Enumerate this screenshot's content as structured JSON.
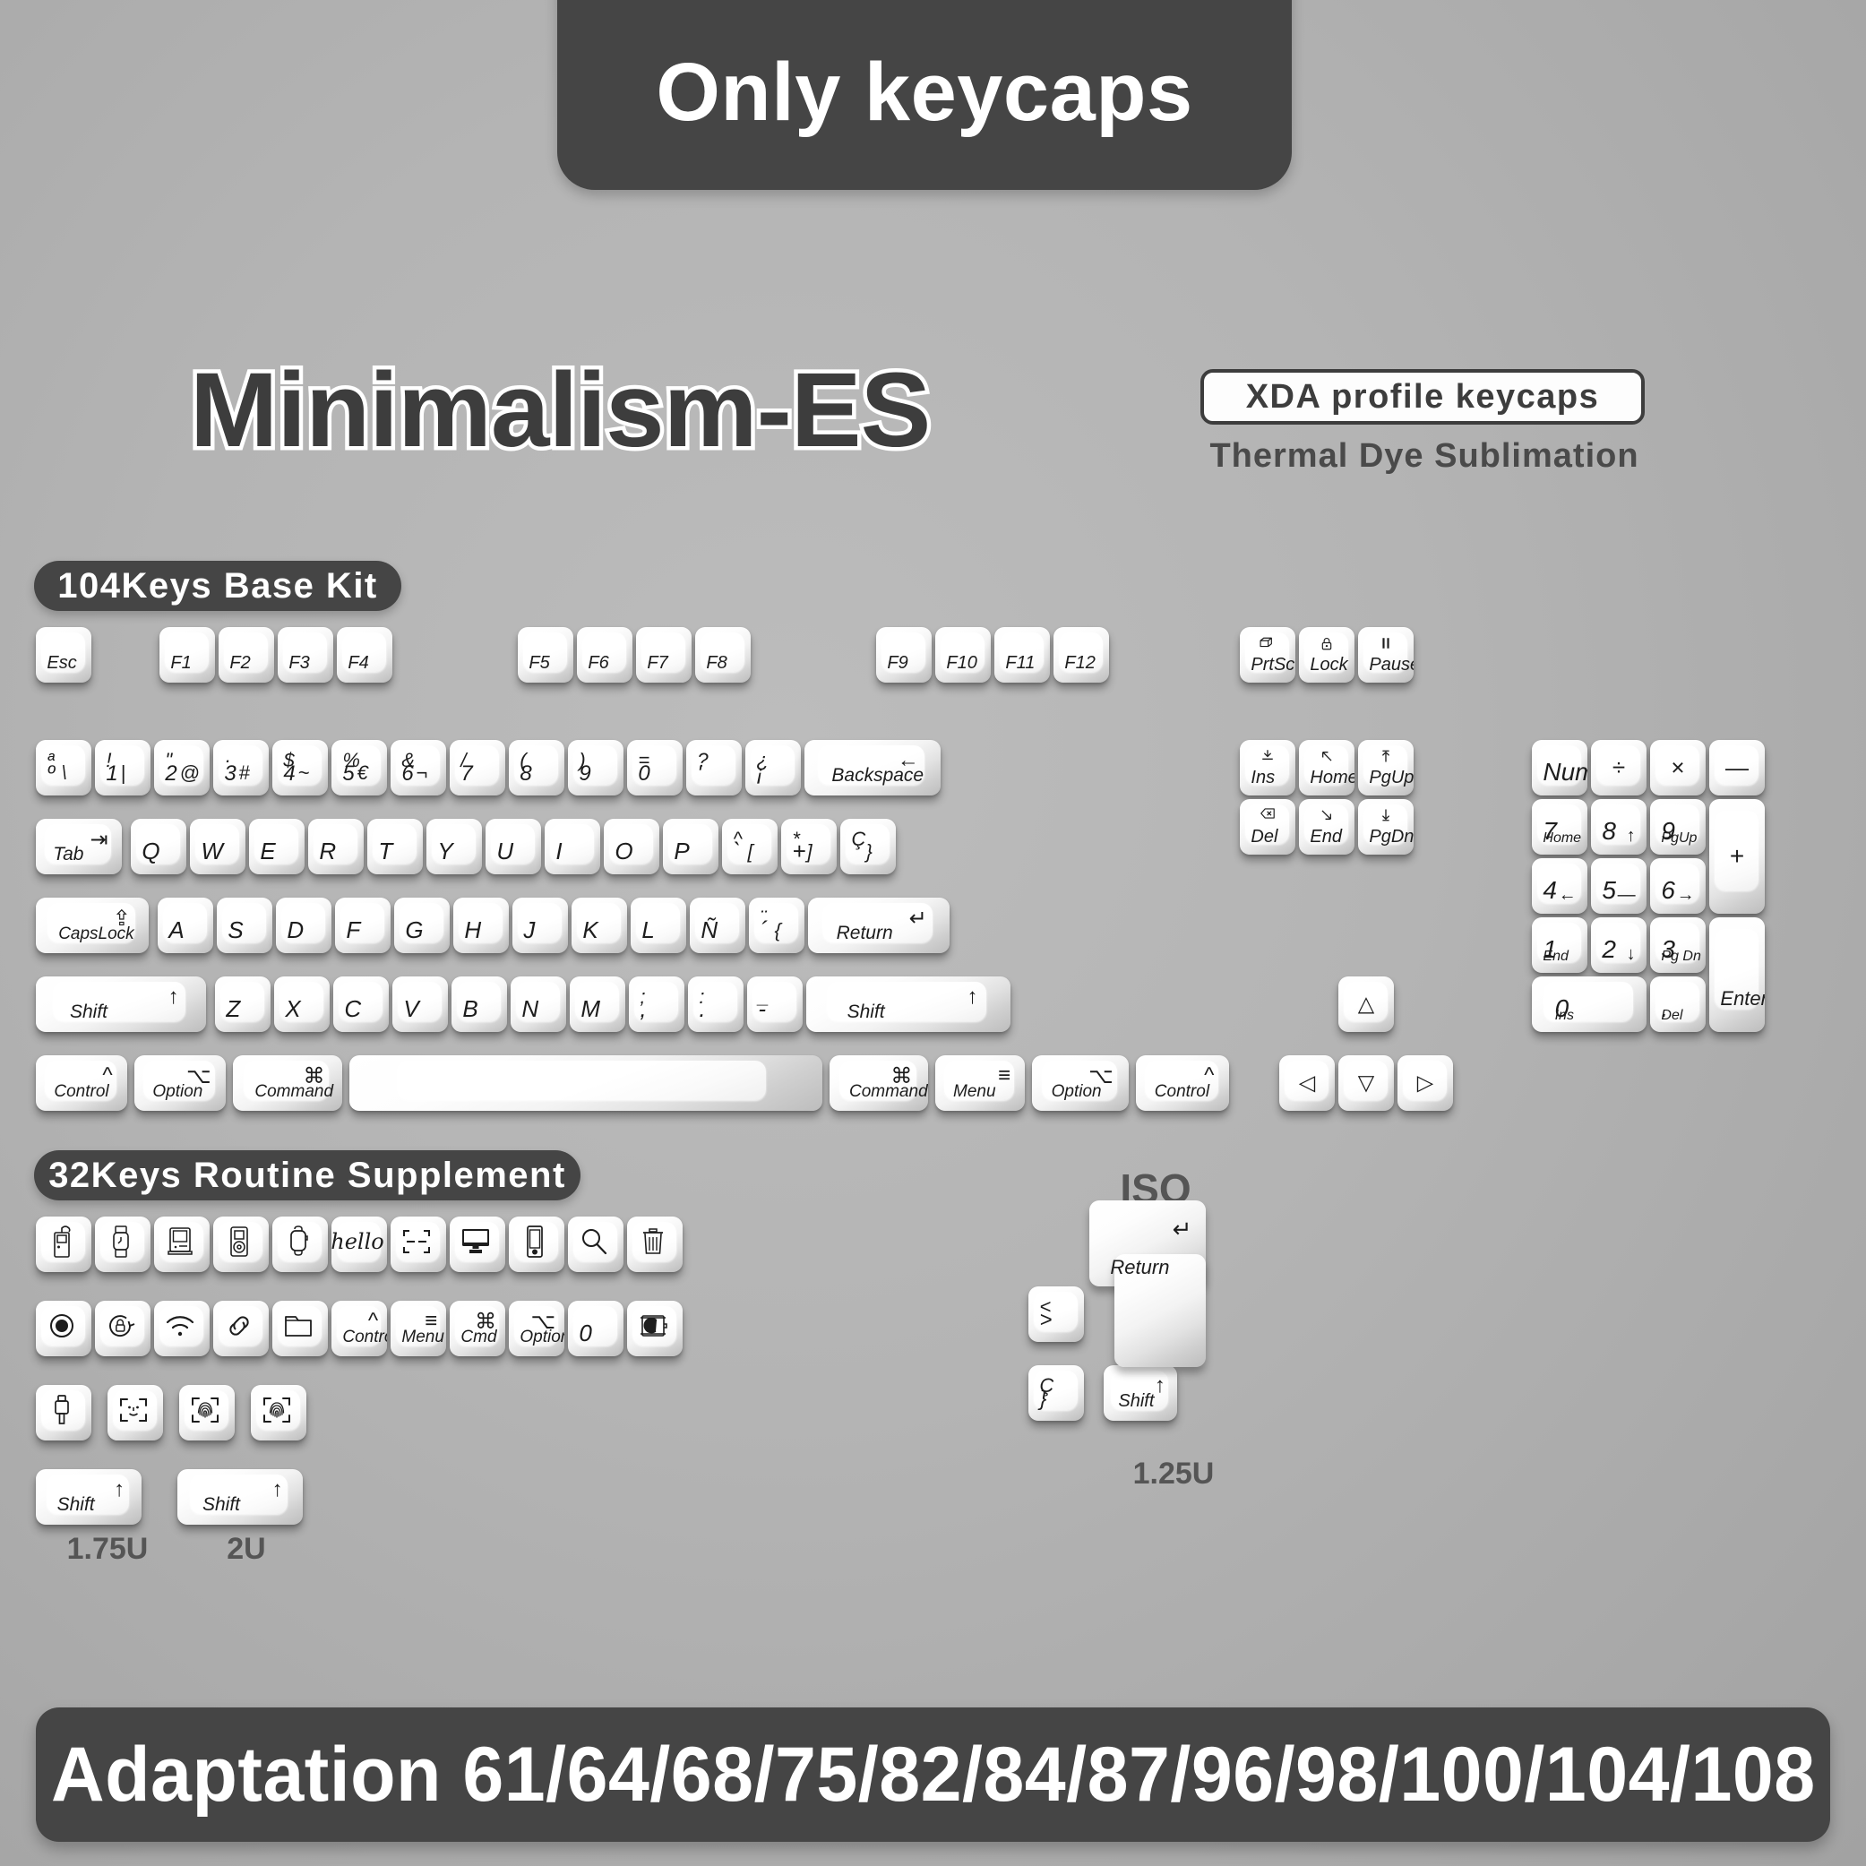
{
  "banners": {
    "top": "Only  keycaps",
    "bottom": "Adaptation 61/64/68/75/82/84/87/96/98/100/104/108"
  },
  "headline": "Minimalism-ES",
  "badges": {
    "xda": "XDA  profile  keycaps",
    "thermal": "Thermal  Dye  Sublimation"
  },
  "sections": {
    "base_kit": "104Keys  Base  Kit",
    "supplement": "32Keys  Routine  Supplement",
    "iso": "ISO"
  },
  "size_labels": {
    "u125": "1.25U",
    "u175": "1.75U",
    "u2": "2U"
  },
  "function_row": [
    {
      "name": "esc",
      "main": "Esc"
    },
    {
      "name": "f1",
      "main": "F1"
    },
    {
      "name": "f2",
      "main": "F2"
    },
    {
      "name": "f3",
      "main": "F3"
    },
    {
      "name": "f4",
      "main": "F4"
    },
    {
      "name": "f5",
      "main": "F5"
    },
    {
      "name": "f6",
      "main": "F6"
    },
    {
      "name": "f7",
      "main": "F7"
    },
    {
      "name": "f8",
      "main": "F8"
    },
    {
      "name": "f9",
      "main": "F9"
    },
    {
      "name": "f10",
      "main": "F10"
    },
    {
      "name": "f11",
      "main": "F11"
    },
    {
      "name": "f12",
      "main": "F12"
    }
  ],
  "number_row": [
    {
      "name": "key-masculine",
      "top": "ª",
      "main": "º",
      "sub": "\\"
    },
    {
      "name": "key-1",
      "top": "!",
      "main": "1",
      "sub": "|"
    },
    {
      "name": "key-2",
      "top": "\"",
      "main": "2",
      "sub": "@"
    },
    {
      "name": "key-3",
      "top": "·",
      "main": "3",
      "sub": "#"
    },
    {
      "name": "key-4",
      "top": "$",
      "main": "4",
      "sub": "~"
    },
    {
      "name": "key-5",
      "top": "%",
      "main": "5",
      "sub": "€"
    },
    {
      "name": "key-6",
      "top": "&",
      "main": "6",
      "sub": "¬"
    },
    {
      "name": "key-7",
      "top": "/",
      "main": "7",
      "sub": ""
    },
    {
      "name": "key-8",
      "top": "(",
      "main": "8",
      "sub": ""
    },
    {
      "name": "key-9",
      "top": ")",
      "main": "9",
      "sub": ""
    },
    {
      "name": "key-0",
      "top": "=",
      "main": "0",
      "sub": ""
    },
    {
      "name": "key-apostrophe",
      "top": "?",
      "main": "'",
      "sub": ""
    },
    {
      "name": "key-inverted-question",
      "top": "¿",
      "main": "¡",
      "sub": ""
    },
    {
      "name": "key-backspace",
      "main": "Backspace",
      "tr": "←"
    }
  ],
  "qwerty_row": [
    {
      "name": "key-tab",
      "main": "Tab",
      "tr": "⇥"
    },
    {
      "name": "key-q",
      "main": "Q"
    },
    {
      "name": "key-w",
      "main": "W"
    },
    {
      "name": "key-e",
      "main": "E"
    },
    {
      "name": "key-r",
      "main": "R"
    },
    {
      "name": "key-t",
      "main": "T"
    },
    {
      "name": "key-y",
      "main": "Y"
    },
    {
      "name": "key-u",
      "main": "U"
    },
    {
      "name": "key-i",
      "main": "I"
    },
    {
      "name": "key-o",
      "main": "O"
    },
    {
      "name": "key-p",
      "main": "P"
    },
    {
      "name": "key-grave",
      "top": "^",
      "main": "`",
      "sub": "["
    },
    {
      "name": "key-plus",
      "top": "*",
      "main": "+",
      "sub": "]"
    },
    {
      "name": "key-cedilla",
      "top": "Ç",
      "main": "",
      "sub": "}"
    }
  ],
  "home_row": [
    {
      "name": "key-capslock",
      "main": "CapsLock",
      "tr": "⇪"
    },
    {
      "name": "key-a",
      "main": "A"
    },
    {
      "name": "key-s",
      "main": "S"
    },
    {
      "name": "key-d",
      "main": "D"
    },
    {
      "name": "key-f",
      "main": "F"
    },
    {
      "name": "key-g",
      "main": "G"
    },
    {
      "name": "key-h",
      "main": "H"
    },
    {
      "name": "key-j",
      "main": "J"
    },
    {
      "name": "key-k",
      "main": "K"
    },
    {
      "name": "key-l",
      "main": "L"
    },
    {
      "name": "key-enye",
      "main": "Ñ"
    },
    {
      "name": "key-diaeresis",
      "top": "¨",
      "main": "´",
      "sub": "{"
    },
    {
      "name": "key-return",
      "main": "Return",
      "tr": "↵"
    }
  ],
  "shift_row": [
    {
      "name": "key-lshift",
      "main": "Shift",
      "tr": "↑"
    },
    {
      "name": "key-z",
      "main": "Z"
    },
    {
      "name": "key-x",
      "main": "X"
    },
    {
      "name": "key-c",
      "main": "C"
    },
    {
      "name": "key-v",
      "main": "V"
    },
    {
      "name": "key-b",
      "main": "B"
    },
    {
      "name": "key-n",
      "main": "N"
    },
    {
      "name": "key-m",
      "main": "M"
    },
    {
      "name": "key-semicolon",
      "top": ";",
      "main": ",",
      "sub": ""
    },
    {
      "name": "key-colon",
      "top": ":",
      "main": ".",
      "sub": ""
    },
    {
      "name": "key-underscore",
      "top": "_",
      "main": "-",
      "sub": ""
    },
    {
      "name": "key-rshift",
      "main": "Shift",
      "tr": "↑"
    }
  ],
  "bottom_row": [
    {
      "name": "key-lcontrol",
      "main": "Control",
      "tr": "^"
    },
    {
      "name": "key-loption",
      "main": "Option",
      "tr": "⌥"
    },
    {
      "name": "key-lcommand",
      "main": "Command",
      "tr": "⌘"
    },
    {
      "name": "key-space",
      "main": ""
    },
    {
      "name": "key-rcommand",
      "main": "Command",
      "tr": "⌘"
    },
    {
      "name": "key-menu",
      "main": "Menu",
      "tr": "≡"
    },
    {
      "name": "key-roption",
      "main": "Option",
      "tr": "⌥"
    },
    {
      "name": "key-rcontrol",
      "main": "Control",
      "tr": "^"
    }
  ],
  "nav_top": [
    {
      "name": "key-prtsc",
      "main": "PrtSc",
      "icon": "windows-overlap-icon"
    },
    {
      "name": "key-lock",
      "main": "Lock",
      "icon": "padlock-icon"
    },
    {
      "name": "key-pause",
      "main": "Pause",
      "icon": "pause-icon"
    }
  ],
  "nav_cluster": [
    {
      "name": "key-ins",
      "main": "Ins",
      "icon": "insert-icon"
    },
    {
      "name": "key-home",
      "main": "Home",
      "icon": "arrow-up-left-icon"
    },
    {
      "name": "key-pgup",
      "main": "PgUp",
      "icon": "page-up-icon"
    },
    {
      "name": "key-del",
      "main": "Del",
      "icon": "delete-tag-icon"
    },
    {
      "name": "key-end",
      "main": "End",
      "icon": "arrow-down-right-icon"
    },
    {
      "name": "key-pgdn",
      "main": "PgDn",
      "icon": "page-down-icon"
    }
  ],
  "arrows": [
    {
      "name": "key-arrow-up",
      "glyph": "△"
    },
    {
      "name": "key-arrow-left",
      "glyph": "◁"
    },
    {
      "name": "key-arrow-down",
      "glyph": "▽"
    },
    {
      "name": "key-arrow-right",
      "glyph": "▷"
    }
  ],
  "numpad": [
    {
      "name": "key-numlock",
      "main": "Num"
    },
    {
      "name": "key-numpad-divide",
      "glyph": "÷"
    },
    {
      "name": "key-numpad-multiply",
      "glyph": "×"
    },
    {
      "name": "key-numpad-minus",
      "glyph": "—"
    },
    {
      "name": "key-numpad-7",
      "main": "7",
      "sublabel": "Home"
    },
    {
      "name": "key-numpad-8",
      "main": "8",
      "subglyph": "↑"
    },
    {
      "name": "key-numpad-9",
      "main": "9",
      "sublabel": "PgUp"
    },
    {
      "name": "key-numpad-plus",
      "glyph": "+"
    },
    {
      "name": "key-numpad-4",
      "main": "4",
      "subglyph": "←"
    },
    {
      "name": "key-numpad-5",
      "main": "5",
      "subglyph": "—"
    },
    {
      "name": "key-numpad-6",
      "main": "6",
      "subglyph": "→"
    },
    {
      "name": "key-numpad-1",
      "main": "1",
      "sublabel": "End"
    },
    {
      "name": "key-numpad-2",
      "main": "2",
      "subglyph": "↓"
    },
    {
      "name": "key-numpad-3",
      "main": "3",
      "sublabel": "Pg Dn"
    },
    {
      "name": "key-numpad-enter",
      "main": "Enter"
    },
    {
      "name": "key-numpad-0",
      "main": "0",
      "sublabel": "Ins"
    },
    {
      "name": "key-numpad-decimal",
      "main": ".",
      "sublabel": "Del"
    }
  ],
  "supplement_row1": [
    {
      "name": "key-ipod-classic",
      "icon": "ipod-classic-icon"
    },
    {
      "name": "key-apple-watch-band",
      "icon": "apple-watch-band-icon"
    },
    {
      "name": "key-macintosh",
      "icon": "macintosh-icon"
    },
    {
      "name": "key-ipod-nano",
      "icon": "ipod-nano-icon"
    },
    {
      "name": "key-apple-watch",
      "icon": "apple-watch-icon"
    },
    {
      "name": "key-hello",
      "icon": "hello-script-icon",
      "text": "hello"
    },
    {
      "name": "key-scan-frame",
      "icon": "scan-frame-icon"
    },
    {
      "name": "key-imac",
      "icon": "imac-icon"
    },
    {
      "name": "key-iphone",
      "icon": "iphone-icon"
    },
    {
      "name": "key-search",
      "icon": "magnifier-icon"
    },
    {
      "name": "key-trash",
      "icon": "trash-icon"
    }
  ],
  "supplement_row2": [
    {
      "name": "key-record",
      "icon": "record-dot-icon"
    },
    {
      "name": "key-rotation-lock",
      "icon": "rotation-lock-icon"
    },
    {
      "name": "key-wifi",
      "icon": "wifi-icon"
    },
    {
      "name": "key-link",
      "icon": "link-chain-icon"
    },
    {
      "name": "key-folder",
      "icon": "folder-icon"
    },
    {
      "name": "key-supp-control",
      "main": "Control",
      "tr": "^"
    },
    {
      "name": "key-supp-menu",
      "main": "Menu",
      "tr": "≡"
    },
    {
      "name": "key-supp-cmd",
      "main": "Cmd",
      "tr": "⌘"
    },
    {
      "name": "key-supp-option",
      "main": "Option",
      "tr": "⌥"
    },
    {
      "name": "key-supp-zero",
      "main": "0"
    },
    {
      "name": "key-airdrop",
      "icon": "airdrop-box-icon"
    }
  ],
  "supplement_row3": [
    {
      "name": "key-usb-connector",
      "icon": "usb-connector-icon"
    },
    {
      "name": "key-face-id",
      "icon": "face-id-icon"
    },
    {
      "name": "key-touch-id-frame",
      "icon": "touch-id-frame-icon"
    },
    {
      "name": "key-touch-id",
      "icon": "touch-id-icon"
    }
  ],
  "supplement_shifts": [
    {
      "name": "key-shift-175u",
      "main": "Shift",
      "tr": "↑"
    },
    {
      "name": "key-shift-2u",
      "main": "Shift",
      "tr": "↑"
    }
  ],
  "iso_cluster": [
    {
      "name": "key-iso-return",
      "main": "Return",
      "tr": "↵"
    },
    {
      "name": "key-iso-angle",
      "top": "<",
      "main": ">"
    },
    {
      "name": "key-iso-cedilla",
      "top": "Ç",
      "main": "}"
    },
    {
      "name": "key-iso-shift",
      "main": "Shift",
      "tr": "↑"
    }
  ],
  "colors": {
    "background": "#b5b5b5",
    "banner": "#454545",
    "keycap": "#ffffff",
    "legend": "#1d1d1d"
  }
}
